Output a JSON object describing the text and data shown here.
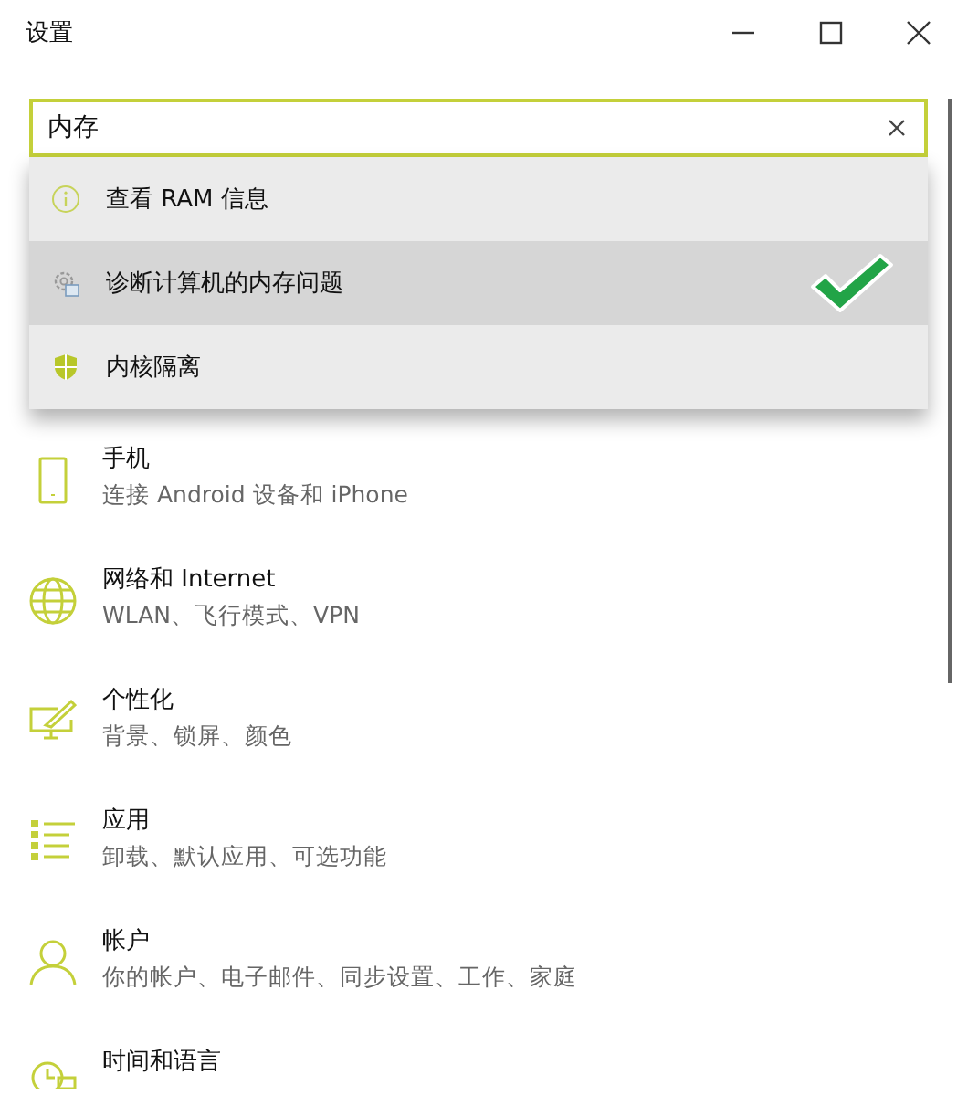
{
  "window": {
    "title": "设置"
  },
  "search": {
    "value": "内存"
  },
  "suggestions": [
    {
      "label": "查看 RAM 信息",
      "selected": false
    },
    {
      "label": "诊断计算机的内存问题",
      "selected": true
    },
    {
      "label": "内核隔离",
      "selected": false
    }
  ],
  "categories": [
    {
      "title": "手机",
      "subtitle": "连接 Android 设备和 iPhone"
    },
    {
      "title": "网络和 Internet",
      "subtitle": "WLAN、飞行模式、VPN"
    },
    {
      "title": "个性化",
      "subtitle": "背景、锁屏、颜色"
    },
    {
      "title": "应用",
      "subtitle": "卸载、默认应用、可选功能"
    },
    {
      "title": "帐户",
      "subtitle": "你的帐户、电子邮件、同步设置、工作、家庭"
    },
    {
      "title": "时间和语言"
    }
  ]
}
